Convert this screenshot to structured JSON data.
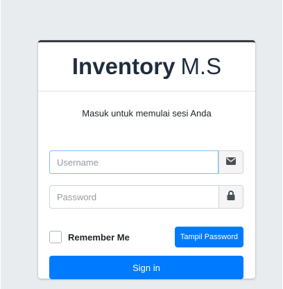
{
  "header": {
    "brand_bold": "Inventory",
    "brand_light": "M.S"
  },
  "login": {
    "message": "Masuk untuk memulai sesi Anda",
    "username": {
      "placeholder": "Username",
      "value": "",
      "icon": "envelope-icon"
    },
    "password": {
      "placeholder": "Password",
      "value": "",
      "icon": "lock-icon"
    },
    "remember_label": "Remember Me",
    "remember_checked": false,
    "show_password_label": "Tampil Password",
    "signin_label": "Sign in"
  },
  "colors": {
    "primary": "#007bff",
    "background": "#e9ecef",
    "card_top_border": "#343a40"
  }
}
